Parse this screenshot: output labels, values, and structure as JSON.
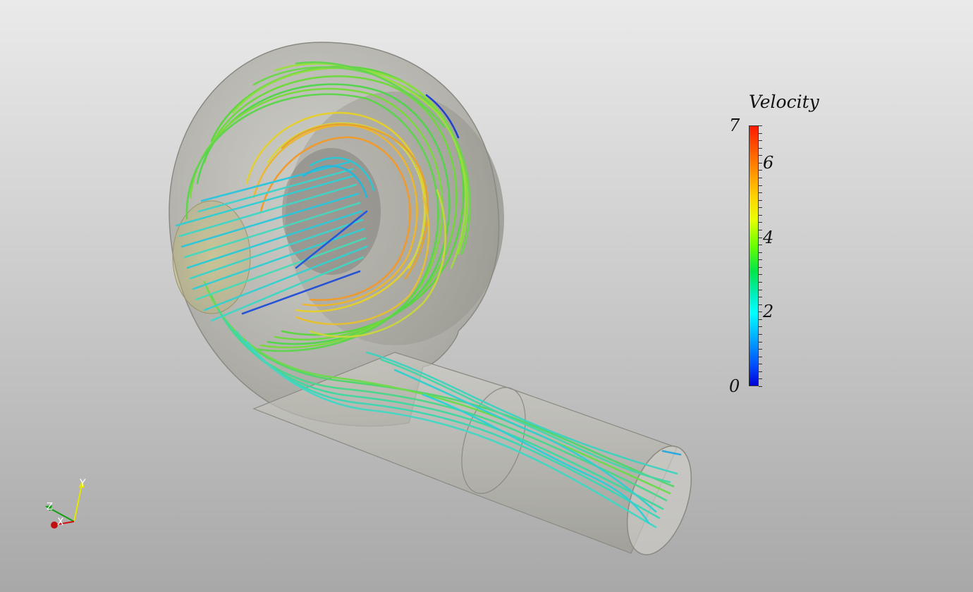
{
  "legend": {
    "title": "Velocity",
    "min": 0,
    "max": 7,
    "ticks": [
      {
        "value": 7,
        "label": "7"
      },
      {
        "value": 6,
        "label": "6"
      },
      {
        "value": 4,
        "label": "4"
      },
      {
        "value": 2,
        "label": "2"
      },
      {
        "value": 0,
        "label": "0"
      }
    ]
  },
  "axes_widget": {
    "x_label": "X",
    "y_label": "Y",
    "z_label": "Z",
    "x_color": "#d01010",
    "y_color": "#e6e600",
    "z_color": "#10a010"
  },
  "colors": {
    "background_top": "#eaeaea",
    "background_bottom": "#a8a8a8",
    "housing": "#b9b8b0"
  }
}
